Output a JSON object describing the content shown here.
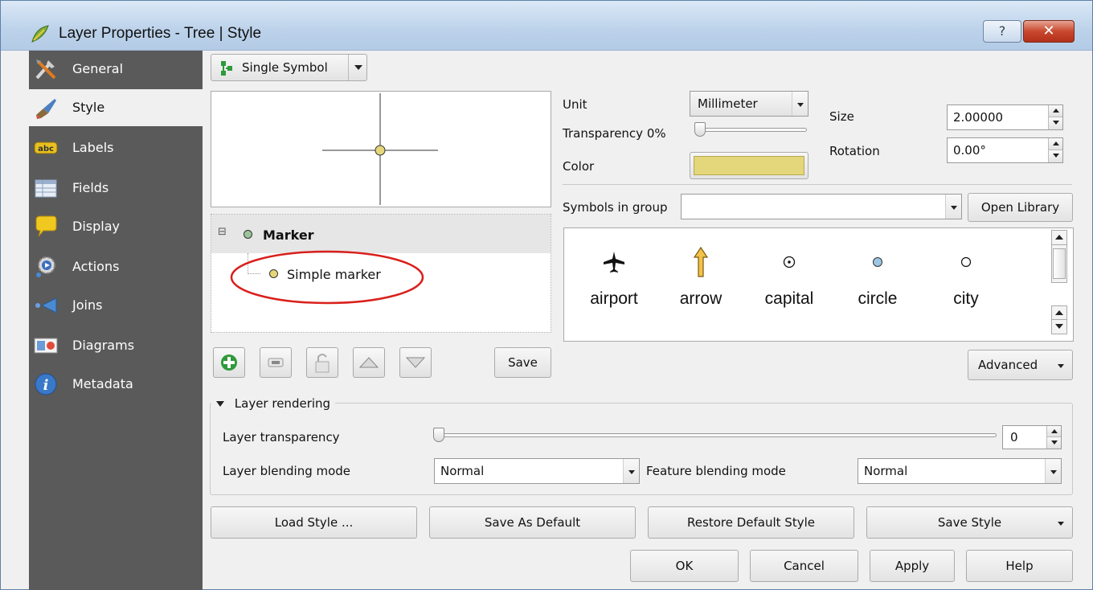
{
  "window": {
    "title": "Layer Properties - Tree | Style",
    "help_label": "?",
    "close_label": "✕"
  },
  "sidebar": {
    "items": [
      {
        "label": "General",
        "icon": "tools-icon"
      },
      {
        "label": "Style",
        "icon": "brush-icon"
      },
      {
        "label": "Labels",
        "icon": "abc-icon"
      },
      {
        "label": "Fields",
        "icon": "table-icon"
      },
      {
        "label": "Display",
        "icon": "speech-bubble-icon"
      },
      {
        "label": "Actions",
        "icon": "gear-icon"
      },
      {
        "label": "Joins",
        "icon": "join-arrow-icon"
      },
      {
        "label": "Diagrams",
        "icon": "diagram-icon"
      },
      {
        "label": "Metadata",
        "icon": "info-icon"
      }
    ],
    "icon_abc_text": "abc",
    "icon_info_text": "i"
  },
  "renderer": {
    "selected": "Single Symbol"
  },
  "symbol_tree": {
    "root": "Marker",
    "child": "Simple marker",
    "expander": "⊟"
  },
  "layer_buttons": {
    "save_label": "Save"
  },
  "properties": {
    "unit_label": "Unit",
    "unit_value": "Millimeter",
    "transparency_label": "Transparency 0%",
    "color_label": "Color",
    "color_value": "#e4d67a",
    "size_label": "Size",
    "size_value": "2.00000",
    "rotation_label": "Rotation",
    "rotation_value": "0.00°"
  },
  "library": {
    "group_label": "Symbols in group",
    "group_value": "",
    "open_library_label": "Open Library",
    "symbols": [
      {
        "name": "airport",
        "icon": "airplane-icon"
      },
      {
        "name": "arrow",
        "icon": "up-arrow-icon"
      },
      {
        "name": "capital",
        "icon": "dotted-circle-icon"
      },
      {
        "name": "circle",
        "icon": "blue-circle-icon"
      },
      {
        "name": "city",
        "icon": "empty-circle-icon"
      }
    ],
    "advanced_label": "Advanced"
  },
  "layer_rendering": {
    "title": "Layer rendering",
    "transparency_label": "Layer transparency",
    "transparency_value": "0",
    "blending_label": "Layer blending mode",
    "blending_value": "Normal",
    "feature_blending_label": "Feature blending mode",
    "feature_blending_value": "Normal"
  },
  "style_buttons": {
    "load": "Load Style ...",
    "save_default": "Save As Default",
    "restore_default": "Restore Default Style",
    "save_style": "Save Style"
  },
  "dialog_buttons": {
    "ok": "OK",
    "cancel": "Cancel",
    "apply": "Apply",
    "help": "Help"
  },
  "colors": {
    "sidebar_bg": "#5a5a5a",
    "marker_fill": "#e4d67a",
    "annotation_red": "#d9201c"
  }
}
